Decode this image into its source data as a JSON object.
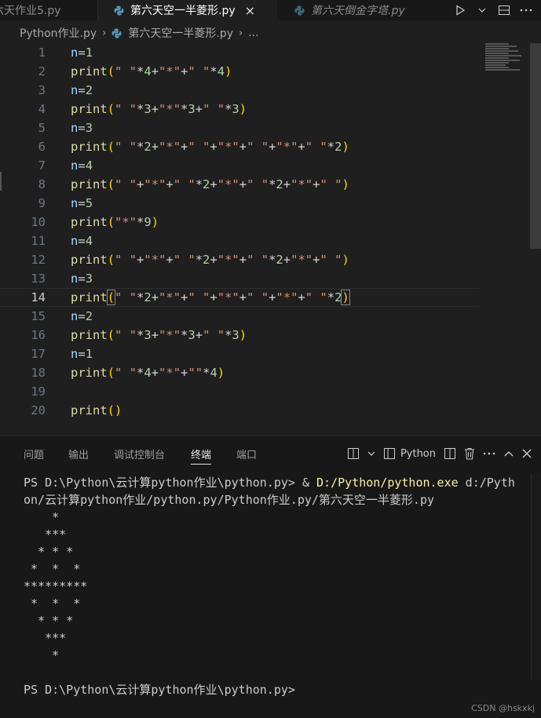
{
  "tabs": [
    {
      "label": "六天作业5.py",
      "active": false
    },
    {
      "label": "第六天空一半菱形.py",
      "active": true,
      "close": "×"
    },
    {
      "label": "第六天倒金字塔.py",
      "active": false
    }
  ],
  "breadcrumb": {
    "folder": "Python作业.py",
    "file": "第六天空一半菱形.py",
    "more": "..."
  },
  "editor": {
    "active_line": 14,
    "lines": [
      {
        "n": "1"
      },
      {
        "n": "2"
      },
      {
        "n": "3"
      },
      {
        "n": "4"
      },
      {
        "n": "5"
      },
      {
        "n": "6"
      },
      {
        "n": "7"
      },
      {
        "n": "8"
      },
      {
        "n": "9"
      },
      {
        "n": "10"
      },
      {
        "n": "11"
      },
      {
        "n": "12"
      },
      {
        "n": "13"
      },
      {
        "n": "14"
      },
      {
        "n": "15"
      },
      {
        "n": "16"
      },
      {
        "n": "17"
      },
      {
        "n": "18"
      },
      {
        "n": "19"
      },
      {
        "n": "20"
      }
    ]
  },
  "panel": {
    "tabs": [
      "问题",
      "输出",
      "调试控制台",
      "终端",
      "端口"
    ],
    "active_tab": "终端",
    "terminal_profile": "Python",
    "terminal_lines": [
      "PS D:\\Python\\云计算python作业\\python.py> & ",
      "on/云计算python作业/python.py/Python作业.py/第六天空一半菱形.py",
      "    *",
      "   ***",
      "  * * *",
      " *  *  *",
      "*********",
      " *  *  *",
      "  * * *",
      "   ***",
      "    *",
      "",
      "PS D:\\Python\\云计算python作业\\python.py>"
    ],
    "exe_path": "D:/Python/python.exe",
    "cmd_tail": " d:/Pyth"
  },
  "watermark": "CSDN @hskxkj",
  "colors": {
    "accent_yellow": "#ffd700",
    "string": "#ce9178",
    "keyword_fn": "#dcdcaa",
    "variable": "#9cdcfe"
  }
}
